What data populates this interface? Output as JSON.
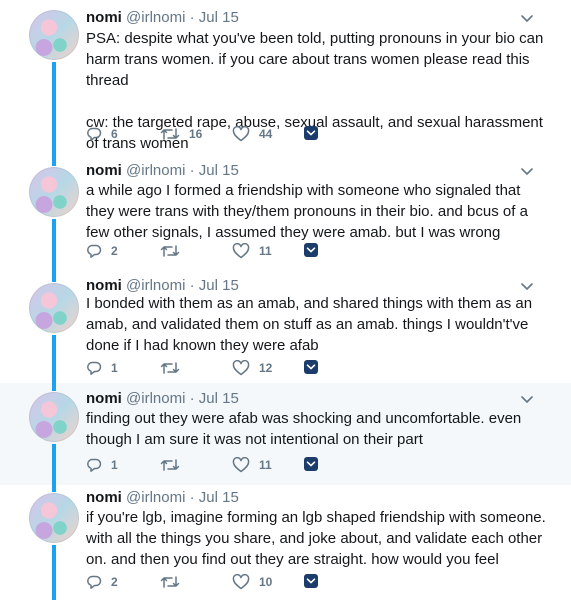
{
  "tweets": [
    {
      "name": "nomi",
      "handle": "@irlnomi",
      "dot": "·",
      "time": "Jul 15",
      "text": "PSA: despite what you've been told, putting pronouns in your bio can harm trans women. if you care about trans women please read this thread\n\ncw: the targeted rape, abuse, sexual assault, and sexual harassment of trans women",
      "replies": "6",
      "retweets": "16",
      "likes": "44",
      "highlighted": false
    },
    {
      "name": "nomi",
      "handle": "@irlnomi",
      "dot": "·",
      "time": "Jul 15",
      "text": "a while ago I formed a friendship with someone who signaled that they were trans with they/them pronouns in their bio. and bcus of a few other signals, I assumed they were amab. but I was wrong",
      "replies": "2",
      "retweets": "",
      "likes": "11",
      "highlighted": false
    },
    {
      "name": "nomi",
      "handle": "@irlnomi",
      "dot": "·",
      "time": "Jul 15",
      "text": "I bonded with them as an amab, and shared things with them as an amab, and validated them on stuff as an amab. things I wouldn't've done if I had known they were afab",
      "replies": "1",
      "retweets": "",
      "likes": "12",
      "highlighted": false
    },
    {
      "name": "nomi",
      "handle": "@irlnomi",
      "dot": "·",
      "time": "Jul 15",
      "text": "finding out they were afab was shocking and uncomfortable. even though I am sure it was not intentional on their part",
      "replies": "1",
      "retweets": "",
      "likes": "11",
      "highlighted": true
    },
    {
      "name": "nomi",
      "handle": "@irlnomi",
      "dot": "·",
      "time": "Jul 15",
      "text": "if you're lgb, imagine forming an lgb shaped friendship with someone. with all the things you share, and joke about, and validate each other on. and then you find out they are straight. how would you feel",
      "replies": "2",
      "retweets": "",
      "likes": "10",
      "highlighted": false
    }
  ],
  "colors": {
    "thread_line": "#1da1f2",
    "muted": "#657786",
    "highlight_bg": "#f5f8fa",
    "dm_icon": "#1c3d6b"
  },
  "icons": [
    "reply-icon",
    "retweet-icon",
    "like-icon",
    "direct-message-icon",
    "chevron-down-icon"
  ]
}
